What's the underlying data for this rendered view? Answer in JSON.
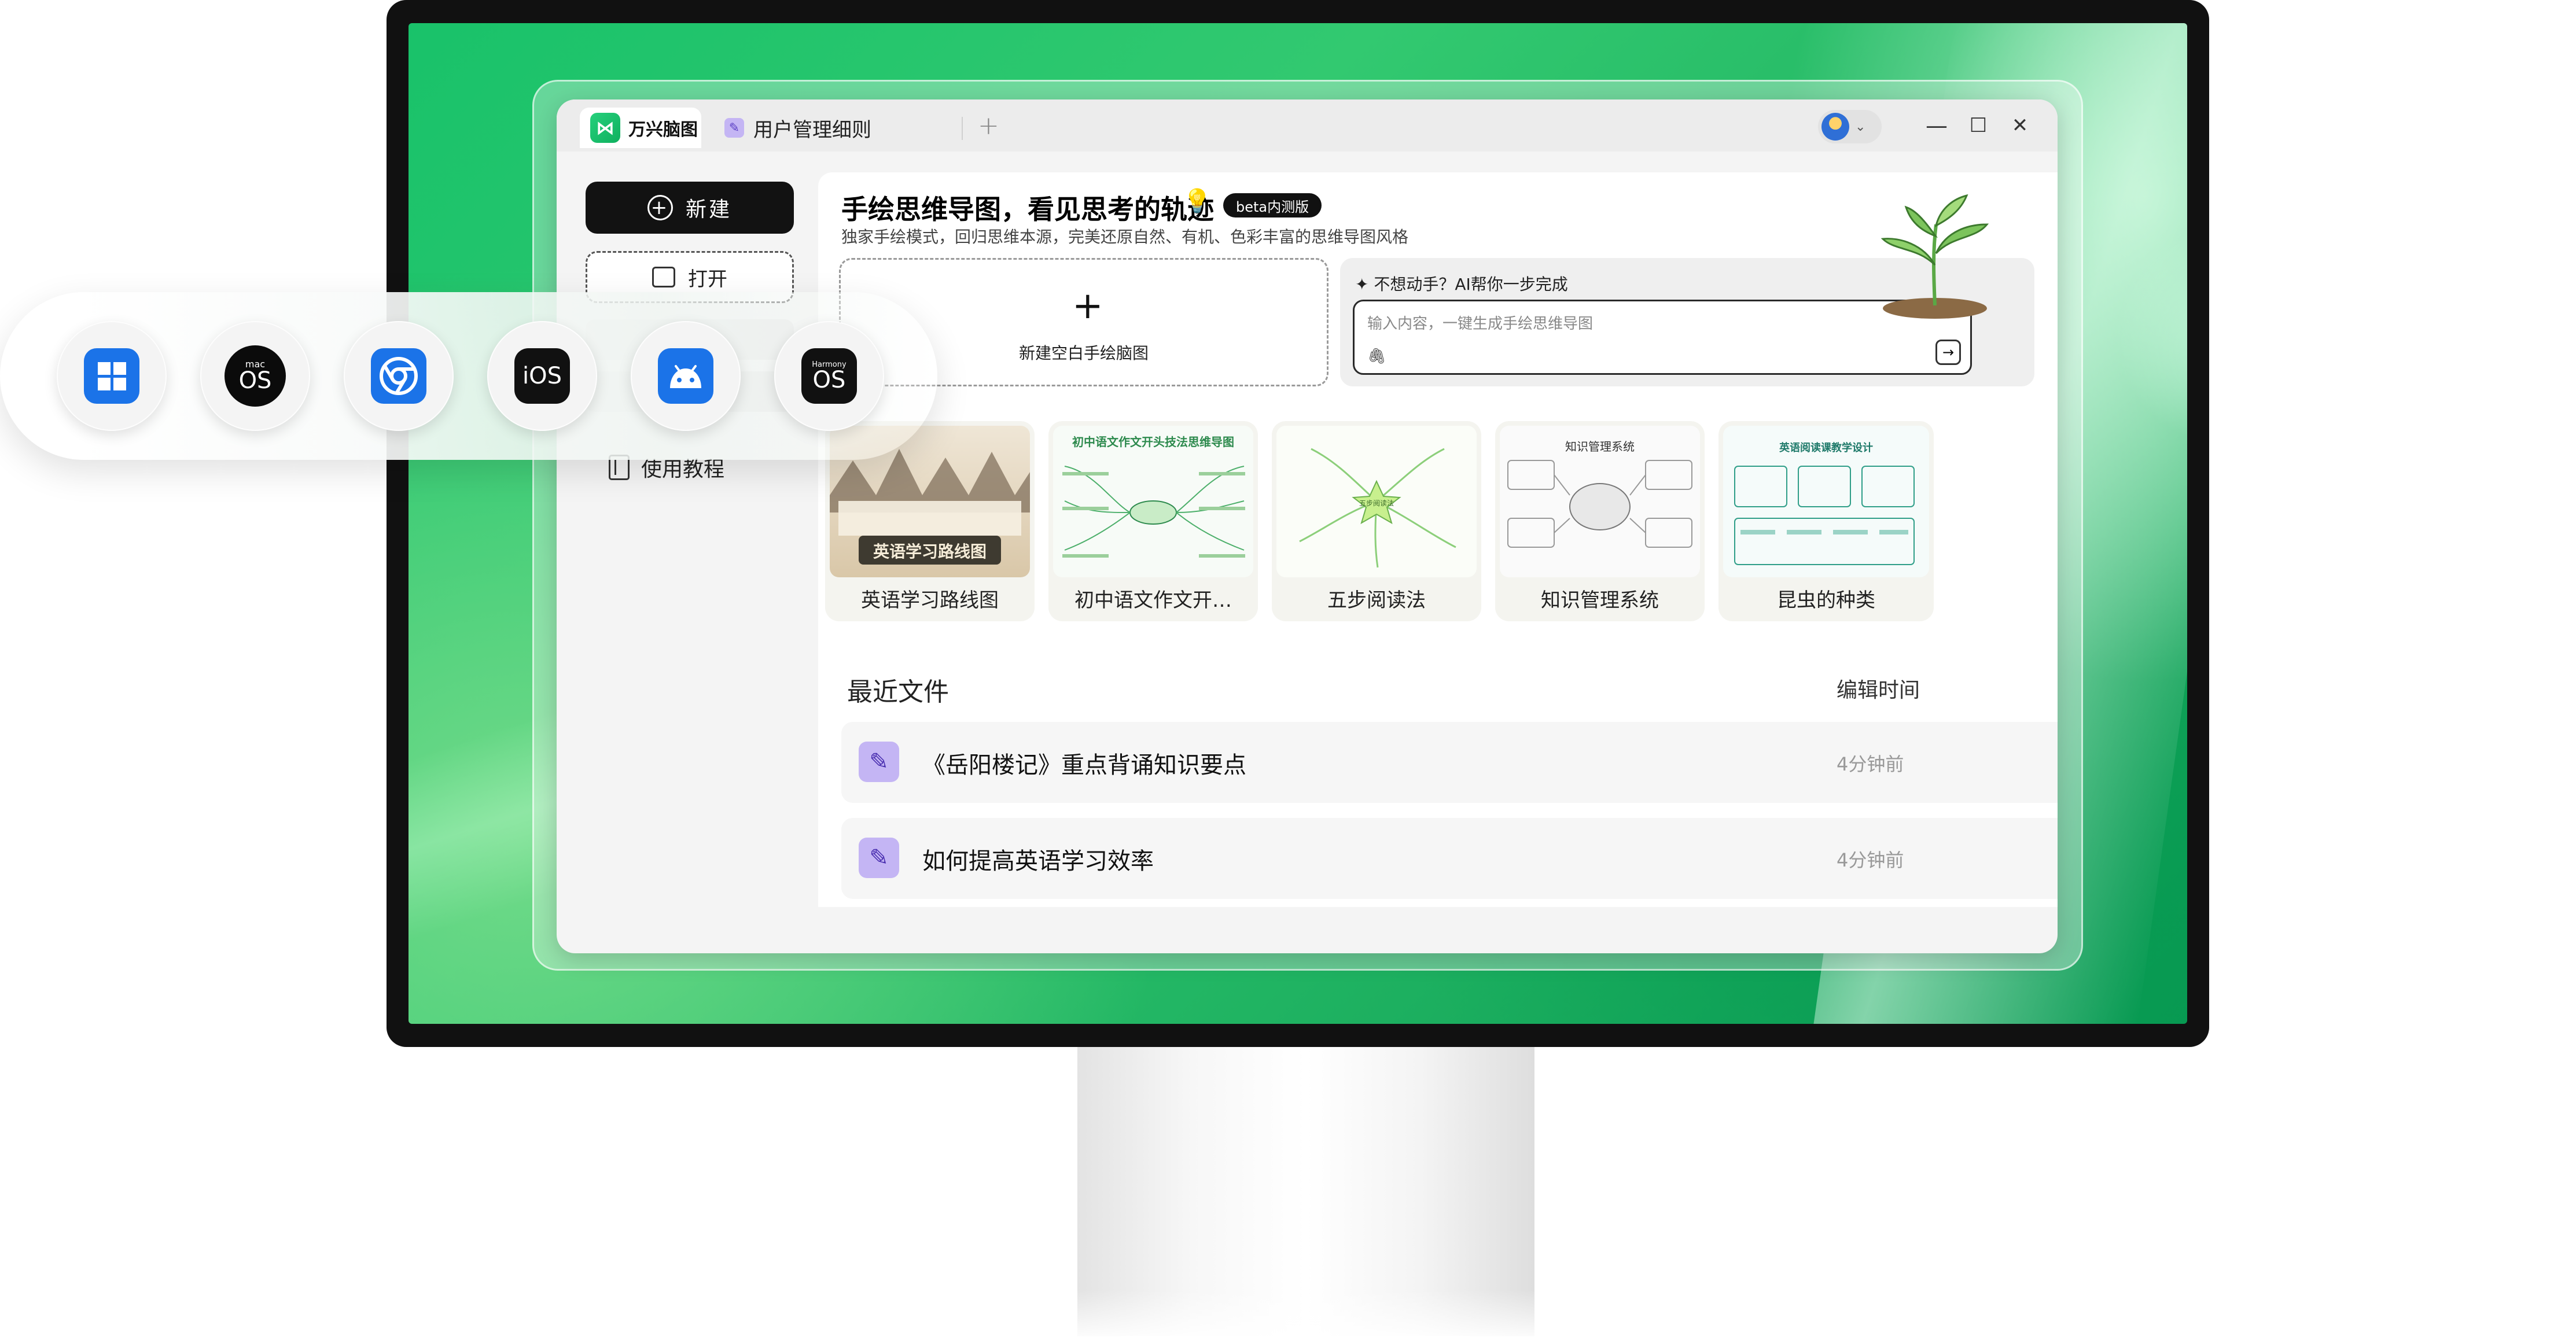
{
  "app": {
    "tabs": [
      {
        "label": "万兴脑图",
        "active": true
      },
      {
        "label": "用户管理细则",
        "active": false
      }
    ],
    "new_tab": "+",
    "window_controls": {
      "minimize": "—",
      "maximize": "☐",
      "close": "✕"
    }
  },
  "sidebar": {
    "new_label": "新建",
    "open_label": "打开",
    "tutorial_label": "使用教程"
  },
  "hero": {
    "title": "手绘思维导图，看见思考的轨迹",
    "badge": "beta内测版",
    "subtitle": "独家手绘模式，回归思维本源，完美还原自然、有机、色彩丰富的思维导图风格",
    "blank_plus": "+",
    "blank_label": "新建空白手绘脑图",
    "ai_title": "不想动手？AI帮你一步完成",
    "ai_placeholder": "输入内容，一键生成手绘思维导图",
    "ai_send": "→"
  },
  "templates": [
    {
      "label": "英语学习路线图",
      "thumb_text": "英语学习路线图"
    },
    {
      "label": "初中语文作文开…",
      "thumb_text": "初中语文作文开头技法思维导图"
    },
    {
      "label": "五步阅读法",
      "thumb_text": "五步阅读法"
    },
    {
      "label": "知识管理系统",
      "thumb_text": "知识管理系统"
    },
    {
      "label": "昆虫的种类",
      "thumb_text": "英语阅读课教学设计"
    }
  ],
  "recent": {
    "title": "最近文件",
    "column": "编辑时间",
    "files": [
      {
        "name": "《岳阳楼记》重点背诵知识要点",
        "time": "4分钟前"
      },
      {
        "name": "如何提高英语学习效率",
        "time": "4分钟前"
      }
    ]
  },
  "platforms": [
    {
      "name": "windows-icon",
      "label": ""
    },
    {
      "name": "macos-icon",
      "label_top": "mac",
      "label_main": "OS"
    },
    {
      "name": "chrome-icon",
      "label": ""
    },
    {
      "name": "ios-icon",
      "label": "iOS"
    },
    {
      "name": "android-icon",
      "label": ""
    },
    {
      "name": "harmonyos-icon",
      "label_top": "Harmony",
      "label_main": "OS"
    }
  ],
  "colors": {
    "brand_green": "#1fc46f",
    "file_icon_purple": "#c4b5f4",
    "platform_blue": "#1b73e8"
  }
}
